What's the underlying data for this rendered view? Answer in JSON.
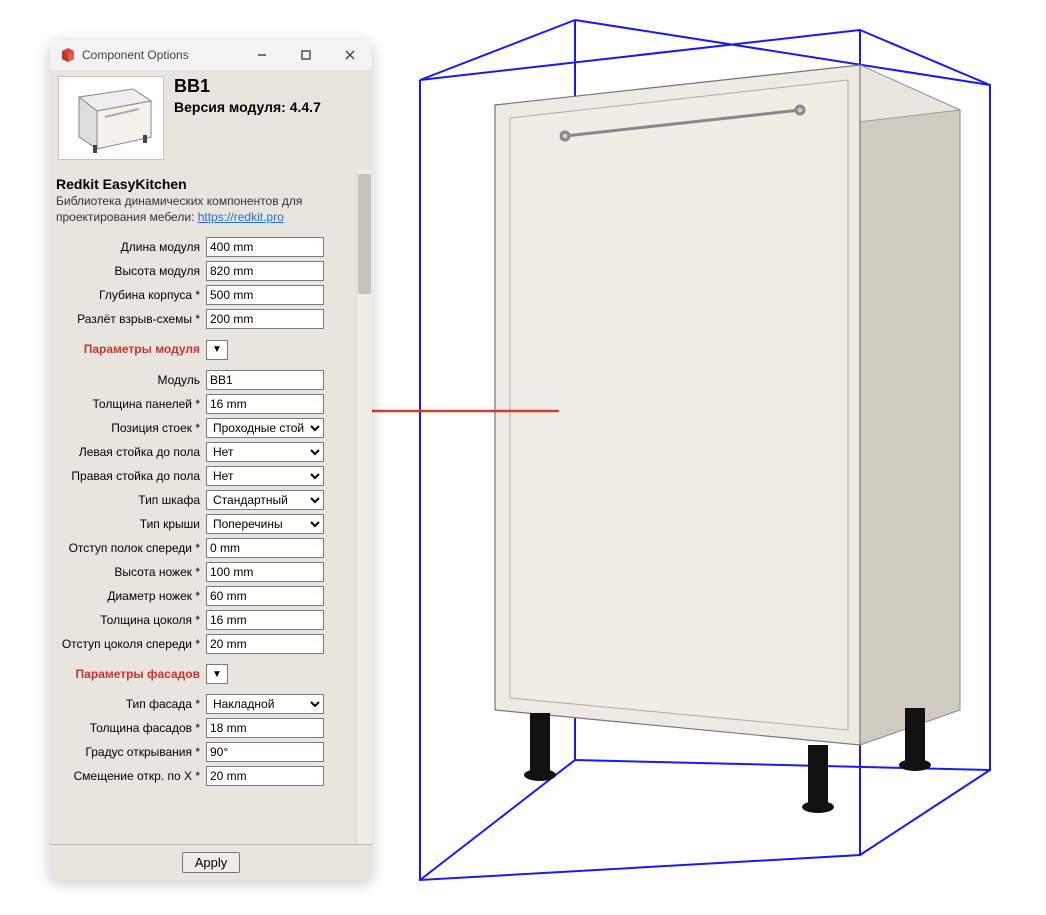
{
  "window": {
    "title": "Component Options"
  },
  "header": {
    "name": "BB1",
    "version_label": "Версия модуля: 4.4.7"
  },
  "subtitle": "Redkit EasyKitchen",
  "description_prefix": "Библиотека динамических компонентов для проектирования мебели: ",
  "description_link": "https://redkit.pro",
  "apply_label": "Apply",
  "fields": {
    "dlina": {
      "label": "Длина модуля",
      "value": "400 mm"
    },
    "vysota": {
      "label": "Высота модуля",
      "value": "820 mm"
    },
    "glubina": {
      "label": "Глубина корпуса *",
      "value": "500 mm"
    },
    "razlet": {
      "label": "Разлёт взрыв-схемы *",
      "value": "200 mm"
    },
    "sec_params": {
      "label": "Параметры модуля",
      "marker": "▼"
    },
    "modul": {
      "label": "Модуль",
      "value": "BB1"
    },
    "tolsh_panel": {
      "label": "Толщина панелей *",
      "value": "16 mm"
    },
    "pos_stoek": {
      "label": "Позиция стоек *",
      "value": "Проходные стойки"
    },
    "levaya": {
      "label": "Левая стойка до пола",
      "value": "Нет"
    },
    "pravaya": {
      "label": "Правая стойка до пола",
      "value": "Нет"
    },
    "tip_shkafa": {
      "label": "Тип шкафа",
      "value": "Стандартный"
    },
    "tip_kryshi": {
      "label": "Тип крыши",
      "value": "Поперечины"
    },
    "otstup_polok": {
      "label": "Отступ полок спереди *",
      "value": "0 mm"
    },
    "vysota_nozhek": {
      "label": "Высота ножек *",
      "value": "100 mm"
    },
    "diametr_nozhek": {
      "label": "Диаметр ножек *",
      "value": "60 mm"
    },
    "tolsh_cokolya": {
      "label": "Толщина цоколя *",
      "value": "16 mm"
    },
    "otstup_cokolya": {
      "label": "Отступ цоколя спереди *",
      "value": "20 mm"
    },
    "sec_fasad": {
      "label": "Параметры фасадов",
      "marker": "▼"
    },
    "tip_fasada": {
      "label": "Тип фасада *",
      "value": "Накладной"
    },
    "tolsh_fasad": {
      "label": "Толщина фасадов *",
      "value": "18 mm"
    },
    "gradus": {
      "label": "Градус открывания *",
      "value": "90°"
    },
    "smesh_x": {
      "label": "Смещение откр. по X *",
      "value": "20 mm"
    }
  }
}
